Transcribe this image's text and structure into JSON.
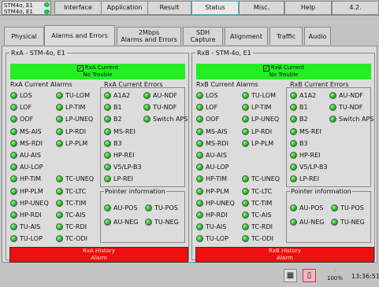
{
  "topbar": {
    "stm_lines": [
      "STM4o, E1",
      "STM4o, E1"
    ],
    "tabs": [
      "Interface",
      "Application",
      "Result",
      "Status",
      "Misc.",
      "Help",
      "4.2."
    ]
  },
  "subtabs": [
    "Physical",
    "Alarms and Errors",
    "2Mbps\nAlarms and Errors",
    "SDH\nCapture",
    "Alignment",
    "Traffic",
    "Audio"
  ],
  "rx": [
    {
      "title": "RxA - STM-4o, E1",
      "current": "RxA  Current",
      "no_trouble": "No Trouble",
      "alarms_hdr": "RxA  Current Alarms",
      "errors_hdr": "RxA  Current Errors",
      "history": "RxA  History",
      "history2": "Alarm"
    },
    {
      "title": "RxB - STM-4o, E1",
      "current": "RxB  Current",
      "no_trouble": "No Trouble",
      "alarms_hdr": "RxB  Current Alarms",
      "errors_hdr": "RxB  Current Errors",
      "history": "RxB  History",
      "history2": "Alarm"
    }
  ],
  "alarms_col1": [
    "LOS",
    "LOF",
    "OOF",
    "MS-AIS",
    "MS-RDI",
    "AU-AIS",
    "AU-LOP",
    "HP-TIM",
    "HP-PLM",
    "HP-UNEQ",
    "HP-RDI",
    "TU-AIS",
    "TU-LOP"
  ],
  "alarms_col2": [
    "TU-LOM",
    "LP-TIM",
    "LP-UNEQ",
    "LP-RDI",
    "LP-PLM",
    "",
    "",
    "TC-UNEQ",
    "TC-LTC",
    "TC-TIM",
    "TC-AIS",
    "TC-RDI",
    "TC-ODI"
  ],
  "errors_col1": [
    "A1A2",
    "B1",
    "B2",
    "MS-REI",
    "B3",
    "HP-REI",
    "V5/LP-B3",
    "LP-REI"
  ],
  "errors_col2": [
    "AU-NDF",
    "TU-NDF",
    "Switch APS"
  ],
  "pointer": {
    "title": "Pointer information",
    "items": [
      "AU-POS",
      "TU-POS",
      "AU-NEG",
      "TU-NEG"
    ]
  },
  "statusbar": {
    "battery": "100%",
    "time": "13:36:51"
  },
  "colors": {
    "ok": "#22ee22",
    "alarm": "#ee1010",
    "led": "#22bb22"
  }
}
